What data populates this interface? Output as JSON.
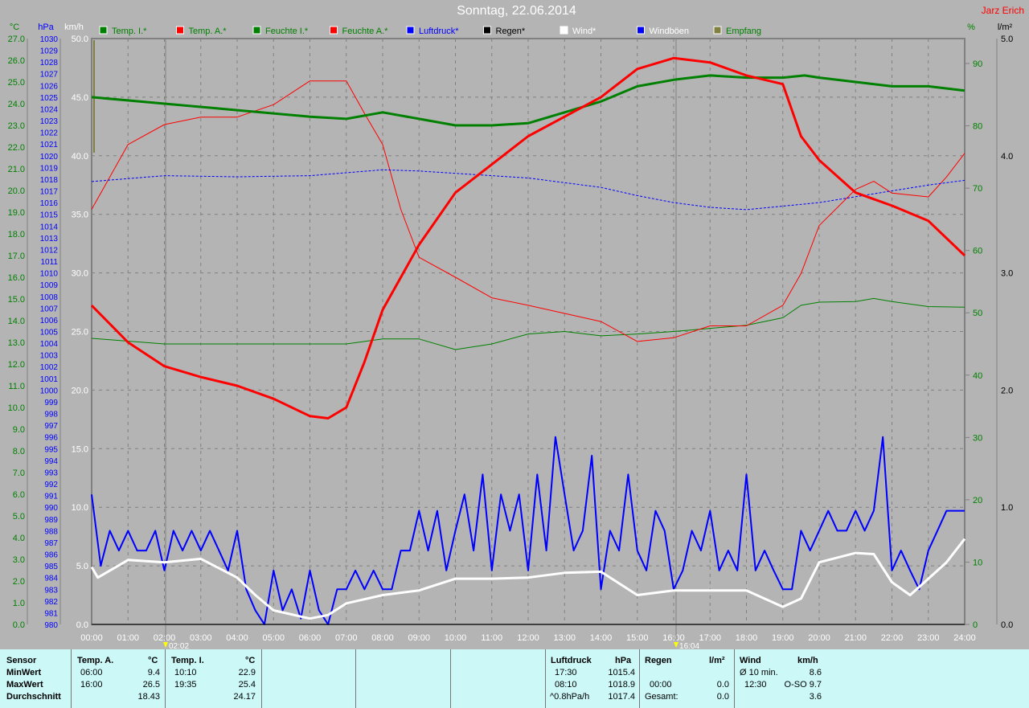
{
  "title": "Sonntag, 22.06.2014",
  "author": "Jarz Erich",
  "legend": [
    {
      "label": "Temp. I.*",
      "color": "#008000",
      "text_color": "#008000"
    },
    {
      "label": "Temp. A.*",
      "color": "#ff0000",
      "text_color": "#008000"
    },
    {
      "label": "Feuchte I.*",
      "color": "#008000",
      "text_color": "#008000"
    },
    {
      "label": "Feuchte A.*",
      "color": "#ff0000",
      "text_color": "#008000"
    },
    {
      "label": "Luftdruck*",
      "color": "#0000ff",
      "text_color": "#0000ff"
    },
    {
      "label": "Regen*",
      "color": "#000000",
      "text_color": "#000000"
    },
    {
      "label": "Wind*",
      "color": "#ffffff",
      "text_color": "#ffffff"
    },
    {
      "label": "Windböen",
      "color": "#0000ff",
      "text_color": "#ffffff"
    },
    {
      "label": "Empfang",
      "color": "#808040",
      "text_color": "#008000"
    }
  ],
  "markers": [
    "02:02",
    "16:04"
  ],
  "chart_data": {
    "type": "line",
    "title": "Sonntag, 22.06.2014",
    "grid": true,
    "x_ticks": [
      "00:00",
      "01:00",
      "02:00",
      "03:00",
      "04:00",
      "05:00",
      "06:00",
      "07:00",
      "08:00",
      "09:00",
      "10:00",
      "11:00",
      "12:00",
      "13:00",
      "14:00",
      "15:00",
      "16:00",
      "17:00",
      "18:00",
      "19:00",
      "20:00",
      "21:00",
      "22:00",
      "23:00",
      "24:00"
    ],
    "xlim": [
      0,
      24
    ],
    "axes": {
      "temp": {
        "unit": "°C",
        "range": [
          0,
          27
        ],
        "step": 1
      },
      "pressure": {
        "unit": "hPa",
        "range": [
          980,
          1030
        ],
        "step": 1
      },
      "wind": {
        "unit": "km/h",
        "range": [
          0,
          50
        ],
        "step": 5
      },
      "humidity": {
        "unit": "%",
        "range": [
          0,
          94
        ],
        "ticks": [
          0,
          10,
          20,
          30,
          40,
          50,
          60,
          70,
          80,
          90
        ]
      },
      "rain": {
        "unit": "l/m²",
        "range": [
          0,
          5
        ],
        "step": 1
      }
    },
    "series": [
      {
        "name": "Temp. A.*",
        "axis": "temp",
        "color": "#ff0000",
        "width": 3,
        "x": [
          0,
          1,
          2,
          3,
          4,
          5,
          6,
          6.5,
          7,
          7.5,
          8,
          9,
          10,
          11,
          12,
          13,
          14,
          15,
          16,
          17,
          18,
          19,
          19.5,
          20,
          21,
          22,
          23,
          24
        ],
        "y": [
          14.7,
          13.0,
          11.9,
          11.4,
          11.0,
          10.4,
          9.6,
          9.5,
          10.0,
          12.1,
          14.5,
          17.5,
          19.9,
          21.2,
          22.5,
          23.4,
          24.3,
          25.6,
          26.1,
          25.9,
          25.3,
          24.9,
          22.5,
          21.4,
          19.9,
          19.3,
          18.6,
          17.0
        ]
      },
      {
        "name": "Temp. I.*",
        "axis": "temp",
        "color": "#008000",
        "width": 3,
        "x": [
          0,
          2,
          4,
          6,
          7,
          8,
          9,
          10,
          11,
          12,
          13,
          14,
          15,
          16,
          17,
          18,
          19,
          19.6,
          20,
          21,
          22,
          23,
          24
        ],
        "y": [
          24.3,
          24.0,
          23.7,
          23.4,
          23.3,
          23.6,
          23.3,
          23.0,
          23.0,
          23.1,
          23.6,
          24.1,
          24.8,
          25.1,
          25.3,
          25.2,
          25.2,
          25.3,
          25.2,
          25.0,
          24.8,
          24.8,
          24.6
        ]
      },
      {
        "name": "Feuchte A.*",
        "axis": "humidity",
        "color": "#ff0000",
        "width": 1,
        "x": [
          0,
          1,
          2,
          3,
          4,
          5,
          6,
          7,
          7.5,
          8,
          8.5,
          9,
          10,
          11,
          12,
          13,
          14,
          15,
          16,
          17,
          18,
          19,
          19.5,
          20,
          21,
          21.5,
          22,
          23,
          23.5,
          24
        ],
        "y": [
          66.6,
          77,
          80.2,
          81.4,
          81.4,
          83.4,
          87.2,
          87.2,
          82,
          77,
          66.6,
          58.9,
          55.7,
          52.4,
          51.2,
          49.9,
          48.6,
          45.4,
          46,
          47.9,
          47.9,
          51.2,
          56.3,
          64,
          69.8,
          71.1,
          69.2,
          68.6,
          71.8,
          75.6
        ]
      },
      {
        "name": "Feuchte I.*",
        "axis": "humidity",
        "color": "#008000",
        "width": 1,
        "x": [
          0,
          2,
          7,
          8,
          9,
          10,
          11,
          12,
          13,
          14,
          15,
          16,
          17,
          18,
          19,
          19.5,
          20,
          21,
          21.5,
          22,
          23,
          24
        ],
        "y": [
          45.9,
          45,
          45,
          45.8,
          45.8,
          44.1,
          45,
          46.6,
          47,
          46.3,
          46.6,
          47,
          47.5,
          48,
          49.2,
          51.2,
          51.7,
          51.8,
          52.3,
          51.8,
          51,
          50.9
        ]
      },
      {
        "name": "Luftdruck*",
        "axis": "pressure",
        "color": "#0000ff",
        "width": 1,
        "dash": true,
        "x": [
          0,
          2,
          4,
          6,
          8,
          9,
          10,
          11,
          12,
          13,
          14,
          15,
          16,
          17,
          18,
          19,
          20,
          21,
          22,
          23,
          24
        ],
        "y": [
          1017.8,
          1018.3,
          1018.2,
          1018.3,
          1018.8,
          1018.7,
          1018.5,
          1018.3,
          1018.1,
          1017.7,
          1017.3,
          1016.6,
          1016.0,
          1015.6,
          1015.4,
          1015.7,
          1016.0,
          1016.5,
          1017.0,
          1017.5,
          1017.9
        ]
      },
      {
        "name": "Windböen",
        "axis": "wind",
        "color": "#0000ff",
        "width": 2,
        "step_minutes": 15,
        "y": [
          11.1,
          5,
          8,
          6.3,
          8,
          6.3,
          6.3,
          8,
          4.6,
          8,
          6.3,
          8,
          6.3,
          8,
          6.3,
          4.6,
          8,
          3,
          1.2,
          0,
          4.6,
          1.2,
          3,
          0.5,
          4.6,
          1.2,
          0,
          3,
          3,
          4.6,
          3,
          4.6,
          3,
          3,
          6.3,
          6.3,
          9.7,
          6.3,
          9.7,
          4.6,
          8,
          11.1,
          6.3,
          12.8,
          4.6,
          11.1,
          8,
          11.1,
          4.6,
          12.8,
          6.3,
          16.0,
          11.1,
          6.3,
          8,
          14.4,
          3,
          8,
          6.3,
          12.8,
          6.3,
          4.6,
          9.7,
          8,
          3,
          4.6,
          8,
          6.3,
          9.7,
          4.6,
          6.3,
          4.6,
          12.8,
          4.6,
          6.3,
          4.6,
          3,
          3,
          8,
          6.3,
          8,
          9.7,
          8,
          8,
          9.7,
          8,
          9.7,
          16.0,
          4.6,
          6.3,
          4.6,
          3,
          6.3,
          8,
          9.7,
          9.7,
          9.7
        ]
      },
      {
        "name": "Wind*",
        "axis": "wind",
        "color": "#ffffff",
        "width": 3,
        "x": [
          0,
          0.17,
          1,
          2,
          3,
          4,
          4.5,
          5,
          6,
          6.5,
          7,
          8,
          9,
          10,
          11,
          12,
          13,
          14,
          15,
          16,
          17,
          18,
          19,
          19.5,
          20,
          21,
          21.5,
          22,
          22.5,
          23,
          23.5,
          24
        ],
        "y": [
          4.9,
          4.0,
          5.5,
          5.3,
          5.6,
          4.0,
          2.5,
          1.2,
          0.5,
          0.8,
          1.8,
          2.5,
          2.9,
          3.9,
          3.9,
          4.0,
          4.4,
          4.5,
          2.5,
          2.9,
          2.9,
          2.9,
          1.5,
          2.2,
          5.3,
          6.1,
          6.0,
          3.6,
          2.5,
          3.9,
          5.3,
          7.3
        ]
      },
      {
        "name": "Regen*",
        "axis": "rain",
        "color": "#000000",
        "width": 1,
        "x": [
          0,
          24
        ],
        "y": [
          0,
          0
        ]
      }
    ]
  },
  "stats": {
    "sensor_col": [
      "Sensor",
      "MinWert",
      "MaxWert",
      "Durchschnitt"
    ],
    "temp_a": {
      "header": "Temp. A.",
      "unit": "°C",
      "min_time": "06:00",
      "min": "9.4",
      "max_time": "16:00",
      "max": "26.5",
      "avg": "18.43"
    },
    "temp_i": {
      "header": "Temp. I.",
      "unit": "°C",
      "min_time": "10:10",
      "min": "22.9",
      "max_time": "19:35",
      "max": "25.4",
      "avg": "24.17"
    },
    "pressure": {
      "header": "Luftdruck",
      "unit": "hPa",
      "min_time": "17:30",
      "min": "1015.4",
      "max_time": "08:10",
      "max": "1018.9",
      "trend": "^0.8hPa/h",
      "avg": "1017.4"
    },
    "rain": {
      "header": "Regen",
      "unit": "l/m²",
      "max_time": "00:00",
      "max": "0.0",
      "total_label": "Gesamt:",
      "total": "0.0"
    },
    "wind": {
      "header": "Wind",
      "unit": "km/h",
      "avg_label": "Ø 10 min.",
      "avg10": "8.6",
      "max_time": "12:30",
      "max": "O-SO 9.7",
      "avg": "3.6"
    }
  }
}
